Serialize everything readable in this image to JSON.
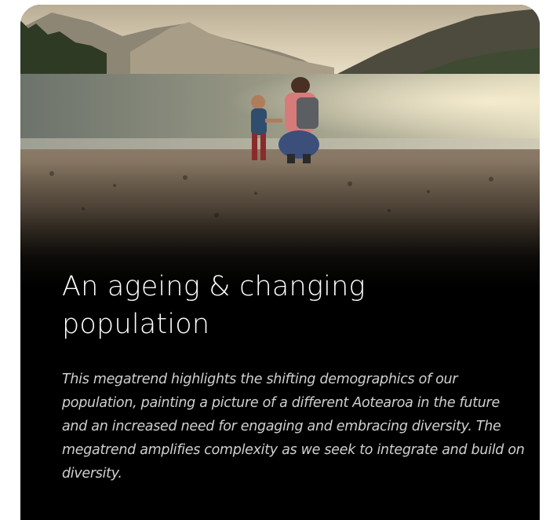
{
  "card": {
    "image_alt": "Mother and toddler on a pebble beach by a mountain lake",
    "title": "An ageing & changing population",
    "description": "This megatrend highlights the shifting demographics of our population, painting a picture of a different Aotearoa in the future and an increased need for engaging and embracing diversity. The megatrend amplifies complexity as we seek to integrate and build on diversity."
  }
}
